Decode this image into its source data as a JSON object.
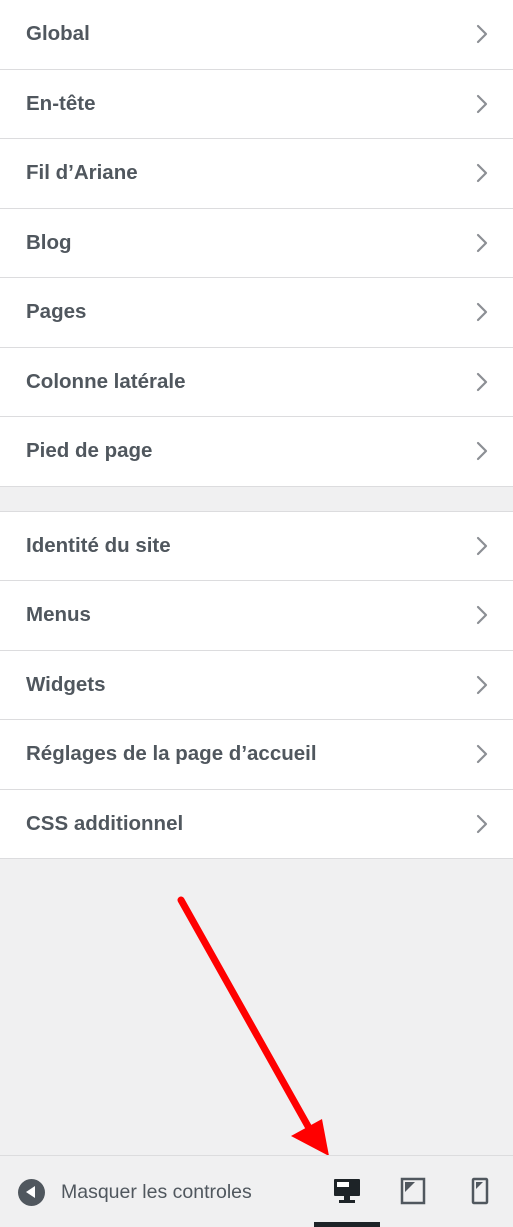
{
  "sections": [
    {
      "items": [
        {
          "label": "Global"
        },
        {
          "label": "En-tête"
        },
        {
          "label": "Fil d’Ariane"
        },
        {
          "label": "Blog"
        },
        {
          "label": "Pages"
        },
        {
          "label": "Colonne latérale"
        },
        {
          "label": "Pied de page"
        }
      ]
    },
    {
      "items": [
        {
          "label": "Identité du site"
        },
        {
          "label": "Menus"
        },
        {
          "label": "Widgets"
        },
        {
          "label": "Réglages de la page d’accueil"
        },
        {
          "label": "CSS additionnel"
        }
      ]
    }
  ],
  "footer": {
    "collapse_label": "Masquer les controles",
    "collapse_icon": "arrow-left-circle-icon",
    "devices": [
      {
        "name": "desktop",
        "icon": "desktop-icon",
        "active": true
      },
      {
        "name": "tablet",
        "icon": "tablet-icon",
        "active": false
      },
      {
        "name": "mobile",
        "icon": "mobile-icon",
        "active": false
      }
    ]
  },
  "annotation": {
    "arrow_color": "#ff0000"
  },
  "colors": {
    "text": "#50575e",
    "background": "#f0f0f1",
    "border": "#dcdcde",
    "active": "#1d2327"
  }
}
